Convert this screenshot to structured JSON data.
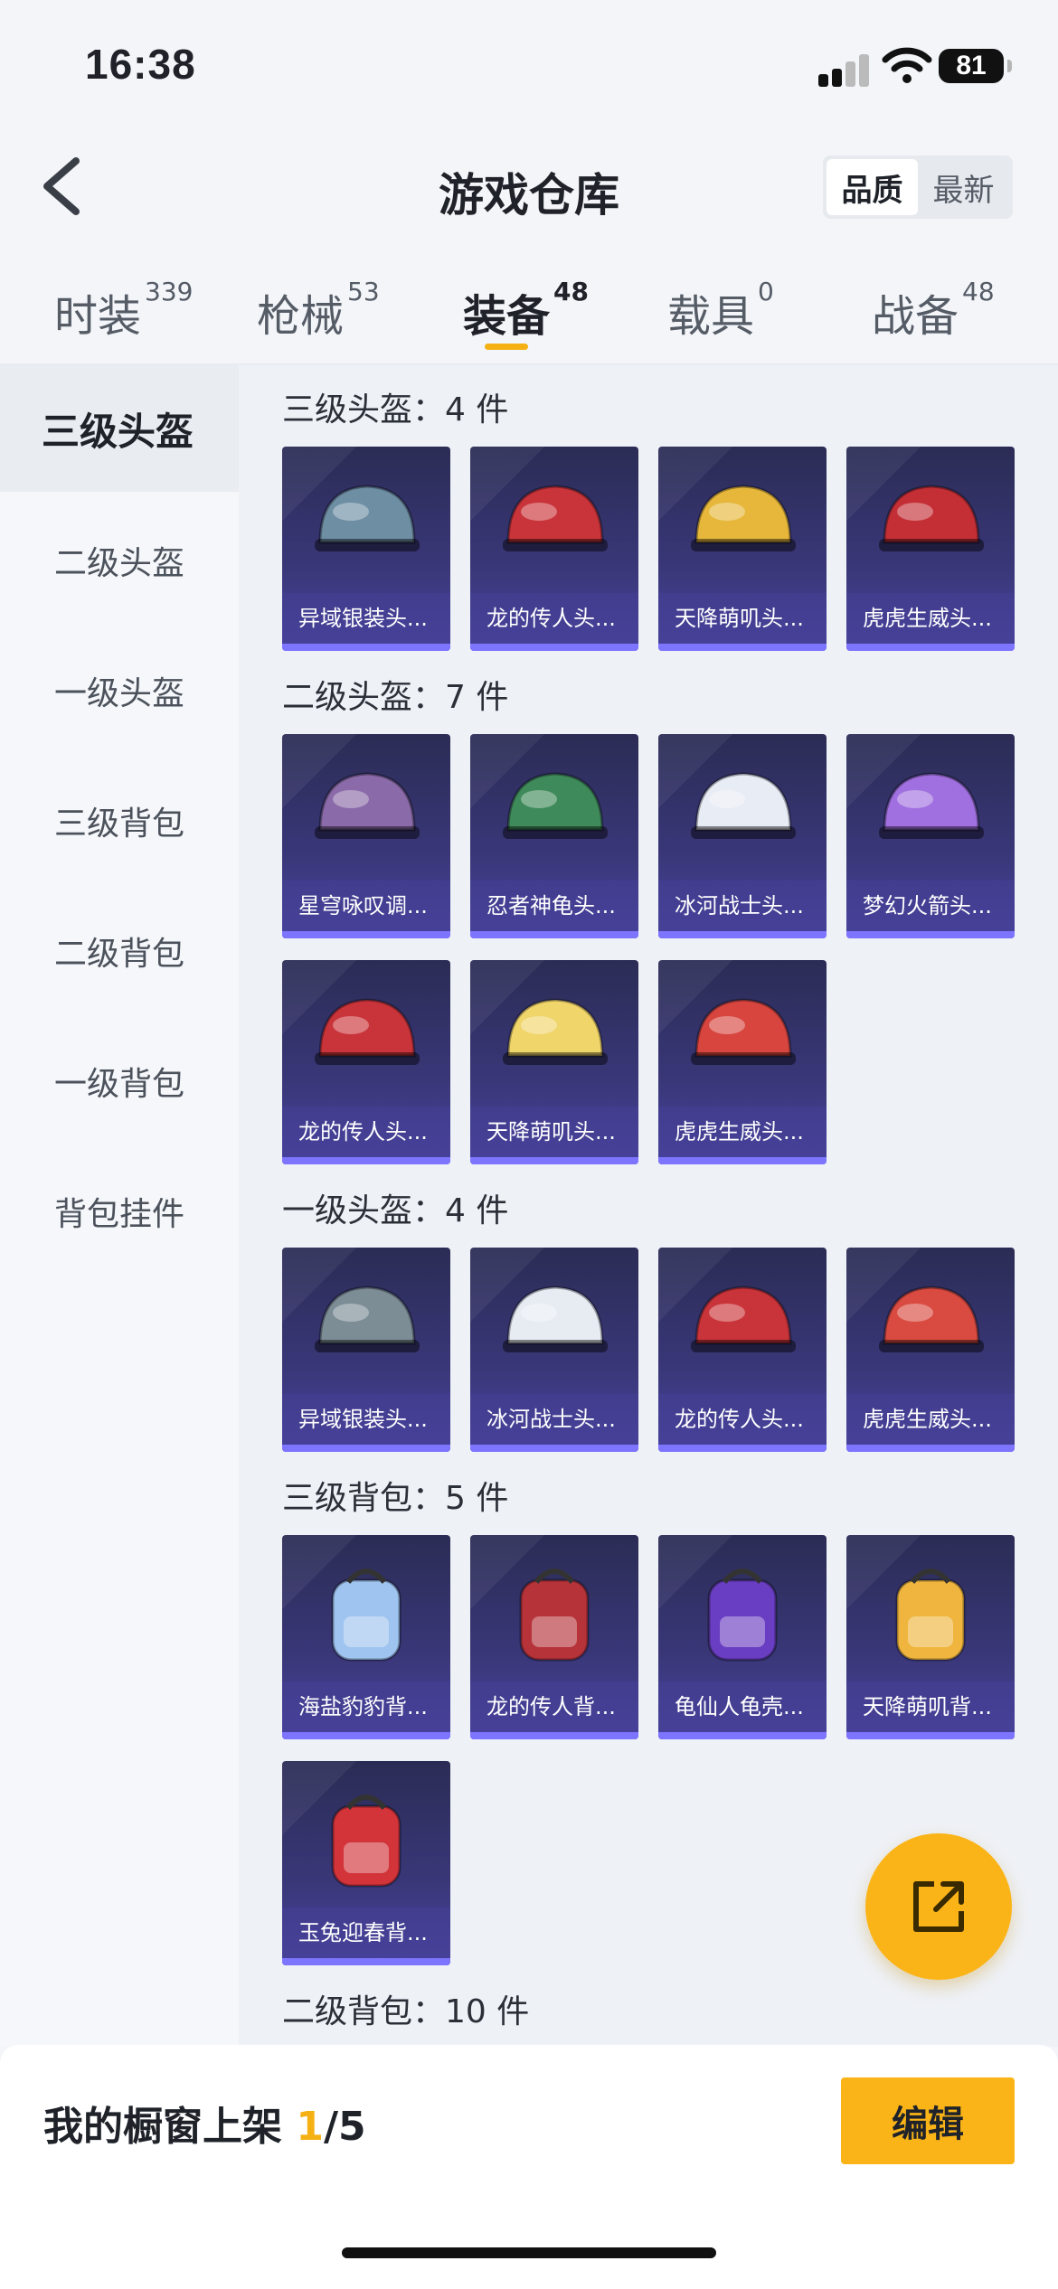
{
  "status_bar": {
    "time": "16:38",
    "battery": "81"
  },
  "header": {
    "title": "游戏仓库",
    "sort_options": [
      "品质",
      "最新"
    ],
    "sort_selected": "品质"
  },
  "tabs": [
    {
      "label": "时装",
      "count": "339"
    },
    {
      "label": "枪械",
      "count": "53"
    },
    {
      "label": "装备",
      "count": "48",
      "active": true
    },
    {
      "label": "载具",
      "count": "0"
    },
    {
      "label": "战备",
      "count": "48"
    }
  ],
  "side_menu": [
    {
      "label": "三级头盔",
      "active": true
    },
    {
      "label": "二级头盔"
    },
    {
      "label": "一级头盔"
    },
    {
      "label": "三级背包"
    },
    {
      "label": "二级背包"
    },
    {
      "label": "一级背包"
    },
    {
      "label": "背包挂件"
    }
  ],
  "sections": [
    {
      "title": "三级头盔：4 件",
      "items": [
        {
          "name": "异域银装头...",
          "color": "#6e8ea3"
        },
        {
          "name": "龙的传人头...",
          "color": "#c9343a"
        },
        {
          "name": "天降萌叽头...",
          "color": "#e6b73a"
        },
        {
          "name": "虎虎生威头...",
          "color": "#c42f36"
        }
      ]
    },
    {
      "title": "二级头盔：7 件",
      "items": [
        {
          "name": "星穹咏叹调...",
          "color": "#8a6aa8"
        },
        {
          "name": "忍者神龟头...",
          "color": "#3f8a5a"
        },
        {
          "name": "冰河战士头...",
          "color": "#e8ecf5"
        },
        {
          "name": "梦幻火箭头...",
          "color": "#a070e0"
        },
        {
          "name": "龙的传人头...",
          "color": "#c9343a"
        },
        {
          "name": "天降萌叽头...",
          "color": "#f0d56a"
        },
        {
          "name": "虎虎生威头...",
          "color": "#d8453f"
        }
      ]
    },
    {
      "title": "一级头盔：4 件",
      "items": [
        {
          "name": "异域银装头...",
          "color": "#7c8d96"
        },
        {
          "name": "冰河战士头...",
          "color": "#e7ecf3"
        },
        {
          "name": "龙的传人头...",
          "color": "#c9343a"
        },
        {
          "name": "虎虎生威头...",
          "color": "#d94a40"
        }
      ]
    },
    {
      "title": "三级背包：5 件",
      "items": [
        {
          "name": "海盐豹豹背...",
          "color": "#9fc4ef"
        },
        {
          "name": "龙的传人背...",
          "color": "#b6333a"
        },
        {
          "name": "龟仙人龟壳...",
          "color": "#6a3ec2"
        },
        {
          "name": "天降萌叽背...",
          "color": "#efb53e"
        },
        {
          "name": "玉兔迎春背...",
          "color": "#d2343a"
        }
      ]
    },
    {
      "title": "二级背包：10 件",
      "items": []
    }
  ],
  "bottom_bar": {
    "label": "我的橱窗上架 ",
    "current": "1",
    "total": "/5",
    "edit_label": "编辑"
  }
}
